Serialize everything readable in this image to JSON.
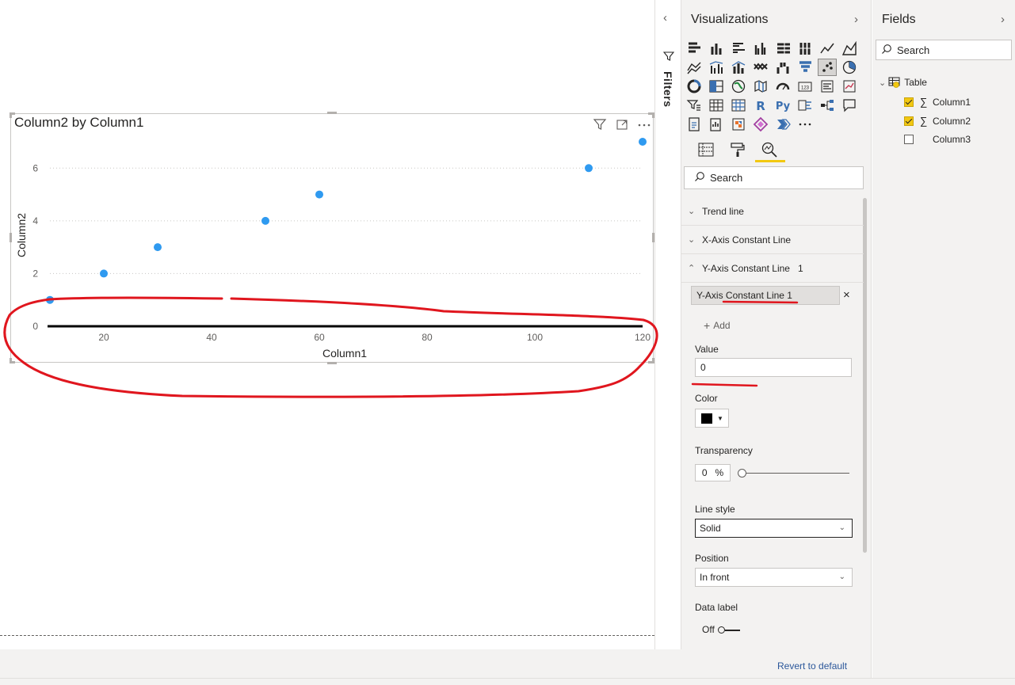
{
  "visual": {
    "title": "Column2 by Column1",
    "filter_icon": "filter-icon",
    "focus_icon": "focus-mode-icon",
    "more_icon": "more-options-icon"
  },
  "chart_data": {
    "type": "scatter",
    "xlabel": "Column1",
    "ylabel": "Column2",
    "xlim": [
      10,
      120
    ],
    "ylim": [
      0,
      7
    ],
    "x_ticks": [
      "20",
      "40",
      "60",
      "80",
      "100",
      "120"
    ],
    "y_ticks": [
      "0",
      "2",
      "4",
      "6"
    ],
    "points": [
      {
        "x": 10,
        "y": 1
      },
      {
        "x": 20,
        "y": 2
      },
      {
        "x": 30,
        "y": 3
      },
      {
        "x": 50,
        "y": 4
      },
      {
        "x": 60,
        "y": 5
      },
      {
        "x": 110,
        "y": 6
      },
      {
        "x": 120,
        "y": 7
      }
    ],
    "constant_line": {
      "axis": "y",
      "value": 0,
      "color": "#000000"
    },
    "point_color": "#2f9af0",
    "grid": "dotted horizontal"
  },
  "filters": {
    "label": "Filters"
  },
  "viz_pane": {
    "title": "Visualizations",
    "search_placeholder": "Search",
    "sections": {
      "trend_line": "Trend line",
      "x_const": "X-Axis Constant Line",
      "y_const": "Y-Axis Constant Line",
      "y_const_count": "1"
    },
    "line_item": "Y-Axis Constant Line 1",
    "add_label": "Add",
    "value_label": "Value",
    "value": "0",
    "color_label": "Color",
    "color_value": "#000000",
    "transparency_label": "Transparency",
    "transparency_value": "0",
    "transparency_unit": "%",
    "transparency_fraction": 0,
    "line_style_label": "Line style",
    "line_style_value": "Solid",
    "position_label": "Position",
    "position_value": "In front",
    "data_label_label": "Data label",
    "data_label_value": "Off",
    "revert": "Revert to default"
  },
  "fields_pane": {
    "title": "Fields",
    "search_placeholder": "Search",
    "table_name": "Table",
    "fields": [
      {
        "name": "Column1",
        "checked": true,
        "sigma": true
      },
      {
        "name": "Column2",
        "checked": true,
        "sigma": true
      },
      {
        "name": "Column3",
        "checked": false,
        "sigma": false
      }
    ]
  },
  "colors": {
    "accent": "#f2c811",
    "annotation_red": "#e0161e",
    "link": "#2b579a"
  }
}
